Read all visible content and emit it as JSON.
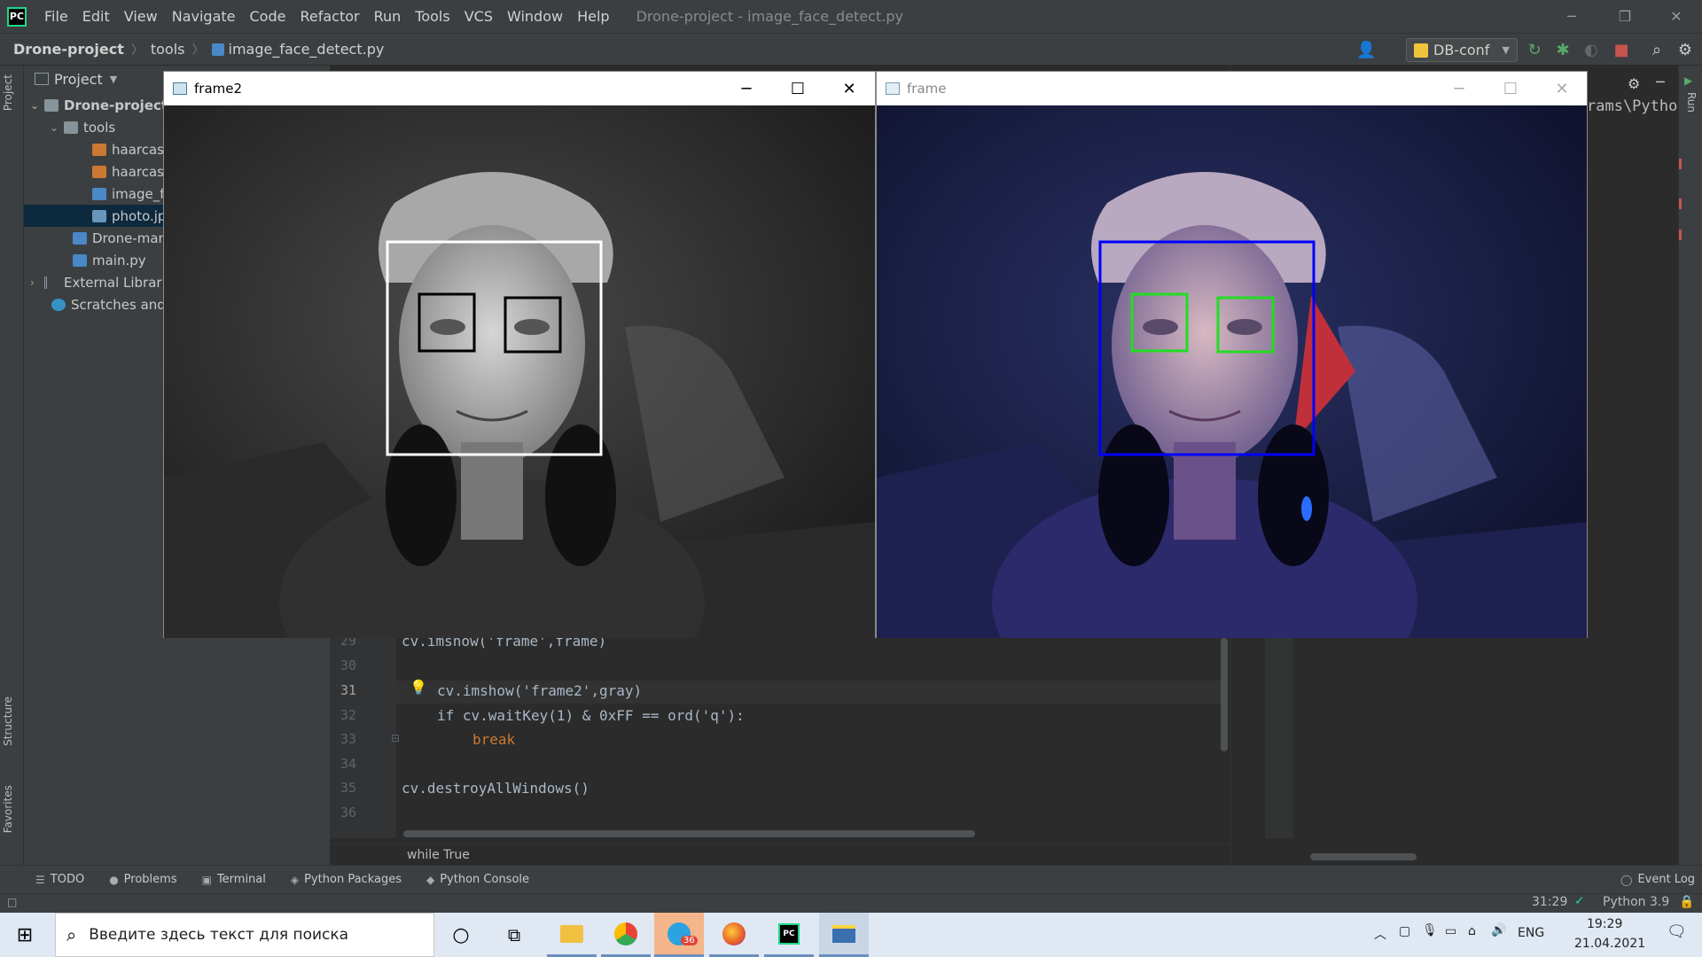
{
  "ide": {
    "menu": [
      "File",
      "Edit",
      "View",
      "Navigate",
      "Code",
      "Refactor",
      "Run",
      "Tools",
      "VCS",
      "Window",
      "Help"
    ],
    "window_title": "Drone-project - image_face_detect.py",
    "logo_text": "PC"
  },
  "navbar": {
    "project": "Drone-project",
    "folder": "tools",
    "file": "image_face_detect.py",
    "run_config": "DB-conf"
  },
  "project_panel": {
    "title": "Project",
    "tree": [
      {
        "label": "Drone-project"
      },
      {
        "label": "tools"
      },
      {
        "label": "haarcasc"
      },
      {
        "label": "haarcasc"
      },
      {
        "label": "image_fa"
      },
      {
        "label": "photo.jpg"
      },
      {
        "label": "Drone-mana"
      },
      {
        "label": "main.py"
      },
      {
        "label": "External Librarie"
      },
      {
        "label": "Scratches and C"
      }
    ]
  },
  "left_stripe": {
    "project": "Project",
    "structure": "Structure",
    "favorites": "Favorites"
  },
  "right_stripe": {
    "run": "Run"
  },
  "editor": {
    "lines": [
      {
        "num": "29",
        "code": "cv.imshow('frame',frame)"
      },
      {
        "num": "30",
        "code": ""
      },
      {
        "num": "31",
        "code": "cv.imshow('frame2',gray)"
      },
      {
        "num": "32",
        "code": "if cv.waitKey(1) & 0xFF == ord('q'):"
      },
      {
        "num": "33",
        "code": "break"
      },
      {
        "num": "34",
        "code": ""
      },
      {
        "num": "35",
        "code": "cv.destroyAllWindows()"
      },
      {
        "num": "36",
        "code": ""
      }
    ],
    "breadcrumb": "while True"
  },
  "run_panel": {
    "path_fragment": "rams\\Pytho"
  },
  "bottom_tabs": [
    "TODO",
    "Problems",
    "Terminal",
    "Python Packages",
    "Python Console"
  ],
  "event_log": "Event Log",
  "status": {
    "position": "31:29",
    "interpreter": "Python 3.9"
  },
  "cv_windows": {
    "left_title": "frame2",
    "right_title": "frame"
  },
  "taskbar": {
    "search_placeholder": "Введите здесь текст для поиска",
    "telegram_badge": "36",
    "language": "ENG",
    "time": "19:29",
    "date": "21.04.2021"
  },
  "colors": {
    "face_box_gray": "#ffffff",
    "eye_box_gray": "#000000",
    "face_box_color": "#0000ff",
    "eye_box_color": "#22dd22"
  }
}
